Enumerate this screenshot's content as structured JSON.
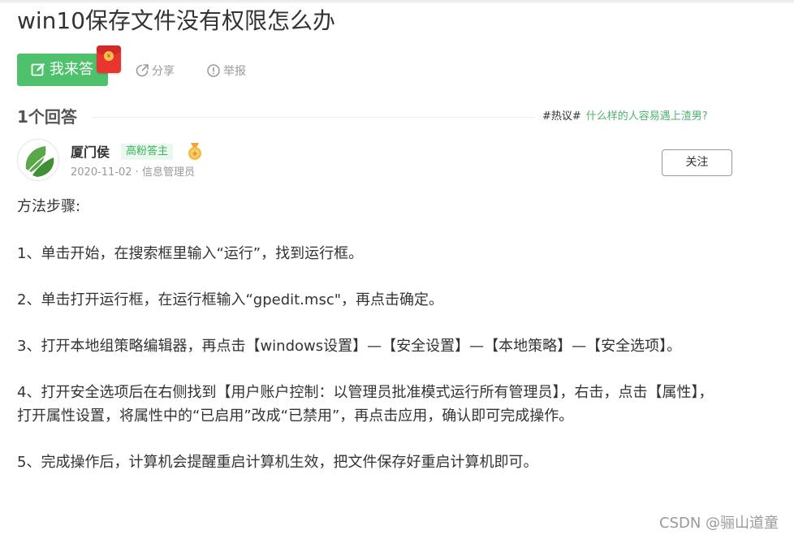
{
  "question": {
    "title": "win10保存文件没有权限怎么办"
  },
  "actions": {
    "answer_label": "我来答",
    "redpacket_coin": "¥",
    "share_label": "分享",
    "report_label": "举报"
  },
  "answers_header": {
    "count_label": "1个回答",
    "hot_tag": "#热议#",
    "hot_link": "什么样的人容易遇上渣男?"
  },
  "answer": {
    "author": "厦门侯",
    "badge": "高粉答主",
    "meta": "2020-11-02 · 信息管理员",
    "follow_label": "关注",
    "heading": "方法步骤:",
    "steps": [
      "1、单击开始，在搜索框里输入“运行”，找到运行框。",
      "2、单击打开运行框，在运行框输入“gpedit.msc\"，再点击确定。",
      "3、打开本地组策略编辑器，再点击【windows设置】—【安全设置】—【本地策略】—【安全选项】。",
      "4、打开安全选项后在右侧找到【用户账户控制：以管理员批准模式运行所有管理员】，右击，点击【属性】，打开属性设置，将属性中的“已启用”改成“已禁用”，再点击应用，确认即可完成操作。",
      "5、完成操作后，计算机会提醒重启计算机生效，把文件保存好重启计算机即可。"
    ]
  },
  "watermark": "CSDN @骊山道童",
  "colors": {
    "accent_green": "#4fc16d",
    "link_green": "#4fb36d",
    "badge_bg": "#e9f7ee",
    "redpacket": "#e8362f"
  },
  "icons": {
    "answer": "edit-icon",
    "share": "share-icon",
    "report": "report-icon",
    "redpacket": "red-packet-icon",
    "medal": "medal-icon",
    "avatar": "leaf-avatar"
  }
}
